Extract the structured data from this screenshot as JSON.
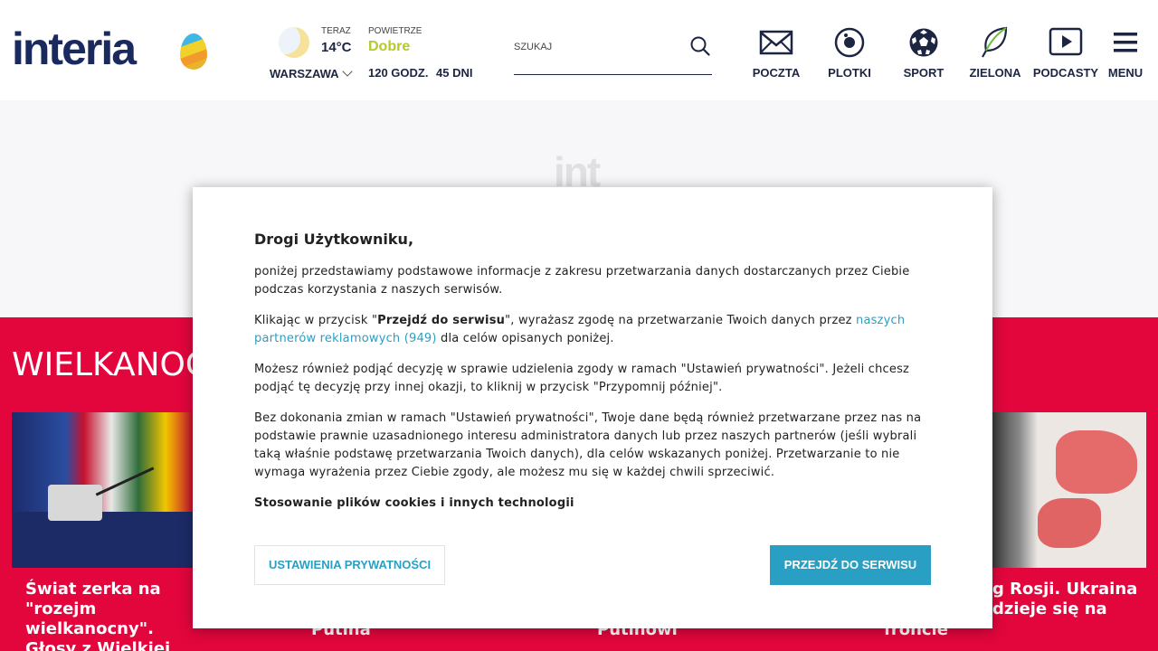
{
  "header": {
    "logo_text": "interia",
    "weather": {
      "now_label": "TERAZ",
      "temperature": "14°C",
      "city": "WARSZAWA",
      "icon": "moon-icon"
    },
    "air": {
      "label": "POWIETRZE",
      "quality": "Dobre",
      "quality_color": "#b6c92a",
      "forecast_hours": "120 GODZ.",
      "forecast_days": "45 DNI"
    },
    "search": {
      "label": "SZUKAJ"
    },
    "nav": [
      {
        "label": "POCZTA",
        "icon": "mail-icon"
      },
      {
        "label": "PLOTKI",
        "icon": "plotki-icon"
      },
      {
        "label": "SPORT",
        "icon": "soccer-ball-icon"
      },
      {
        "label": "ZIELONA",
        "icon": "leaf-icon"
      },
      {
        "label": "PODCASTY",
        "icon": "play-icon"
      },
      {
        "label": "MENU",
        "icon": "hamburger-menu-icon"
      }
    ]
  },
  "ad": {
    "placeholder_logo": "int"
  },
  "section": {
    "title": "WIELKANOC",
    "background": "#e2063d",
    "cards": [
      {
        "title": "Świat zerka na \"rozejm wielkanocny\". Głosy z Wielkiej Brytanii"
      },
      {
        "title": "Putina"
      },
      {
        "title": "Putinowi"
      },
      {
        "title": "g Rosji. Ukraina dzieje się na"
      },
      {
        "title": "froncie"
      }
    ]
  },
  "consent": {
    "title": "Drogi Użytkowniku,",
    "p1": "poniżej przedstawiamy podstawowe informacje z zakresu przetwarzania danych dostarczanych przez Ciebie podczas korzystania z naszych serwisów.",
    "p2_before": "Klikając w przycisk \"",
    "p2_bold": "Przejdź do serwisu",
    "p2_mid": "\", wyrażasz zgodę na przetwarzanie Twoich danych przez ",
    "p2_link": "naszych partnerów reklamowych (949)",
    "p2_after": " dla celów opisanych poniżej.",
    "p3": "Możesz również podjąć decyzję w sprawie udzielenia zgody w ramach \"Ustawień prywatności\". Jeżeli chcesz podjąć tę decyzję przy innej okazji, to kliknij w przycisk \"Przypomnij później\".",
    "p4": "Bez dokonania zmian w ramach \"Ustawień prywatności\", Twoje dane będą również przetwarzane przez nas na podstawie prawnie uzasadnionego interesu administratora danych lub przez naszych partnerów (jeśli wybrali taką właśnie podstawę przetwarzania Twoich danych), dla celów wskazanych poniżej. Przetwarzanie to nie wymaga wyrażenia przez Ciebie zgody, ale możesz mu się w każdej chwili sprzeciwić.",
    "p5": "Stosowanie plików cookies i innych technologii",
    "btn_settings": "USTAWIENIA PRYWATNOŚCI",
    "btn_go": "PRZEJDŹ DO SERWISU",
    "accent": "#2a9fc4"
  }
}
